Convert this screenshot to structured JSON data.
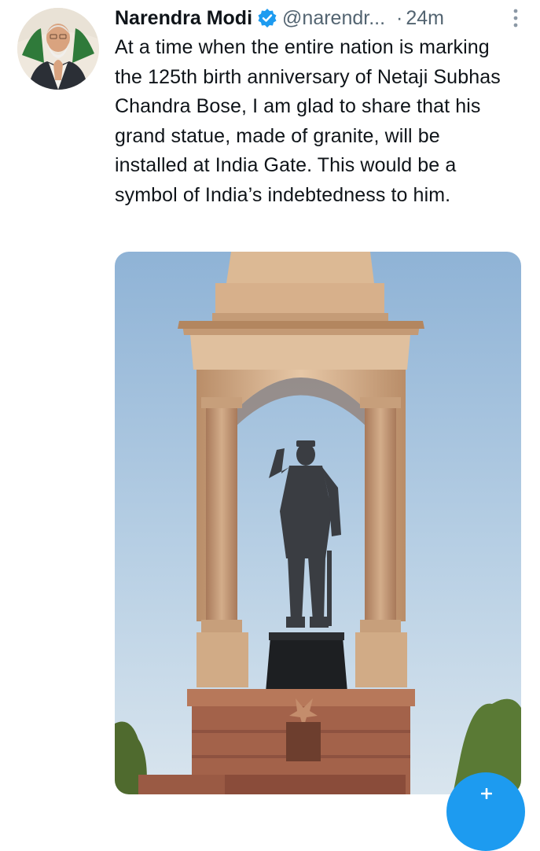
{
  "tweet": {
    "author_name": "Narendra Modi",
    "handle": "@narendr...",
    "separator": "·",
    "time": "24m",
    "text": "At a time when the entire nation is marking the 125th birth anniversary of Netaji Subhas Chandra Bose, I am glad to share that his grand statue, made of granite, will be installed at India Gate. This would be a symbol of India’s indebtedness to him."
  },
  "icons": {
    "verified": "verified-badge-icon",
    "more": "more-vertical-icon",
    "compose": "plus-icon"
  },
  "colors": {
    "verified": "#1d9bf0",
    "fab": "#1d9bf0",
    "muted": "#536471"
  }
}
